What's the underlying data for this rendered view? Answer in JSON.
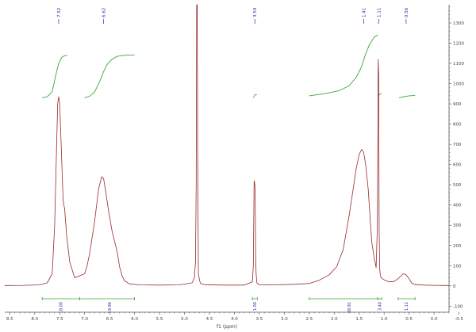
{
  "chart_data": {
    "type": "line",
    "xlabel": "f1 (ppm)",
    "ylabel": "",
    "xlim": [
      8.6,
      -0.3
    ],
    "ylim": [
      -130,
      1390
    ],
    "x_ticks": [
      8.5,
      8.0,
      7.5,
      7.0,
      6.5,
      6.0,
      5.5,
      5.0,
      4.5,
      4.0,
      3.5,
      3.0,
      2.5,
      2.0,
      1.5,
      1.0,
      0.5,
      0.0,
      -0.5
    ],
    "x_tick_labels": [
      "8.5",
      "8.0",
      "7.5",
      "7.0",
      "6.5",
      "6.0",
      "5.5",
      "5.0",
      "4.5",
      "4.0",
      "3.5",
      "3.0",
      "2.5",
      "2.0",
      "1.5",
      "1.0",
      "0.5",
      "0.0",
      "-0.5"
    ],
    "y_ticks": [
      -100,
      0,
      100,
      200,
      300,
      400,
      500,
      600,
      700,
      800,
      900,
      1000,
      1100,
      1200,
      1300
    ],
    "y_tick_labels": [
      "-100",
      "0",
      "100",
      "200",
      "300",
      "400",
      "500",
      "600",
      "700",
      "800",
      "900",
      "1000",
      "1100",
      "1200",
      "1300"
    ],
    "series": [
      {
        "color": "#9a2a2a",
        "x": [
          8.6,
          8.2,
          7.9,
          7.75,
          7.65,
          7.6,
          7.56,
          7.54,
          7.52,
          7.5,
          7.47,
          7.43,
          7.4,
          7.36,
          7.3,
          7.2,
          7.1,
          7.05,
          7.0,
          6.95,
          6.9,
          6.8,
          6.72,
          6.66,
          6.62,
          6.58,
          6.52,
          6.45,
          6.4,
          6.35,
          6.3,
          6.25,
          6.2,
          6.1,
          5.9,
          5.5,
          5.1,
          4.85,
          4.8,
          4.78,
          4.765,
          4.755,
          4.745,
          4.735,
          4.72,
          4.7,
          4.68,
          4.6,
          4.2,
          3.8,
          3.64,
          3.62,
          3.605,
          3.595,
          3.585,
          3.575,
          3.565,
          3.55,
          3.5,
          3.2,
          2.8,
          2.5,
          2.3,
          2.1,
          1.95,
          1.82,
          1.7,
          1.62,
          1.56,
          1.5,
          1.45,
          1.41,
          1.37,
          1.32,
          1.25,
          1.2,
          1.16,
          1.135,
          1.12,
          1.11,
          1.1,
          1.09,
          1.08,
          1.06,
          1.0,
          0.9,
          0.8,
          0.7,
          0.62,
          0.56,
          0.5,
          0.45,
          0.4,
          0.2,
          0.0,
          -0.3
        ],
        "y": [
          2,
          3,
          5,
          15,
          60,
          300,
          700,
          900,
          935,
          900,
          700,
          420,
          380,
          250,
          120,
          40,
          50,
          55,
          60,
          100,
          160,
          320,
          480,
          540,
          530,
          470,
          370,
          270,
          220,
          170,
          95,
          50,
          25,
          10,
          5,
          4,
          5,
          15,
          40,
          120,
          500,
          1390,
          1390,
          600,
          60,
          30,
          12,
          6,
          4,
          4,
          20,
          100,
          520,
          510,
          480,
          170,
          60,
          15,
          6,
          5,
          8,
          12,
          28,
          55,
          95,
          180,
          350,
          480,
          580,
          650,
          675,
          660,
          600,
          480,
          220,
          140,
          90,
          300,
          1120,
          1050,
          300,
          90,
          60,
          40,
          30,
          20,
          22,
          40,
          60,
          55,
          35,
          15,
          8,
          4,
          3,
          2
        ]
      }
    ],
    "integrals": [
      {
        "x": [
          7.85,
          7.75,
          7.65,
          7.58,
          7.52,
          7.46,
          7.4,
          7.35
        ],
        "y": [
          930,
          935,
          960,
          1040,
          1100,
          1130,
          1138,
          1140
        ]
      },
      {
        "x": [
          7.0,
          6.9,
          6.8,
          6.7,
          6.62,
          6.55,
          6.45,
          6.35,
          6.2,
          6.0
        ],
        "y": [
          930,
          938,
          960,
          1010,
          1060,
          1095,
          1120,
          1135,
          1140,
          1142
        ]
      },
      {
        "x": [
          3.62,
          3.6,
          3.58,
          3.55
        ],
        "y": [
          930,
          940,
          946,
          945
        ]
      },
      {
        "x": [
          2.5,
          2.2,
          1.9,
          1.7,
          1.55,
          1.45,
          1.38,
          1.3,
          1.2,
          1.13
        ],
        "y": [
          940,
          950,
          965,
          990,
          1035,
          1085,
          1140,
          1190,
          1230,
          1240
        ]
      },
      {
        "x": [
          1.13,
          1.1,
          1.07,
          1.05
        ],
        "y": [
          940,
          946,
          950,
          950
        ]
      },
      {
        "x": [
          0.7,
          0.6,
          0.5,
          0.38
        ],
        "y": [
          930,
          936,
          940,
          942
        ]
      }
    ],
    "peak_labels": [
      {
        "x": 7.52,
        "label": "7.52"
      },
      {
        "x": 6.62,
        "label": "6.62"
      },
      {
        "x": 3.59,
        "label": "3.59"
      },
      {
        "x": 1.41,
        "label": "1.41"
      },
      {
        "x": 1.11,
        "label": "1.11"
      },
      {
        "x": 0.56,
        "label": "0.56"
      }
    ],
    "integration_ranges": [
      {
        "from": 7.85,
        "to": 7.1,
        "center": 7.48,
        "label": "18.00"
      },
      {
        "from": 7.1,
        "to": 6.0,
        "center": 6.5,
        "label": "19.96"
      },
      {
        "from": 3.64,
        "to": 3.54,
        "center": 3.59,
        "label": "1.00"
      },
      {
        "from": 2.5,
        "to": 1.13,
        "center": 1.7,
        "label": "38.91"
      },
      {
        "from": 1.13,
        "to": 1.05,
        "center": 1.09,
        "label": "3.40"
      },
      {
        "from": 0.72,
        "to": 0.38,
        "center": 0.56,
        "label": "1.11"
      }
    ],
    "colors": {
      "spectrum": "#9a2a2a",
      "integral": "#3aa83a",
      "labels": "#2a2aa0",
      "axis": "#555555"
    }
  }
}
